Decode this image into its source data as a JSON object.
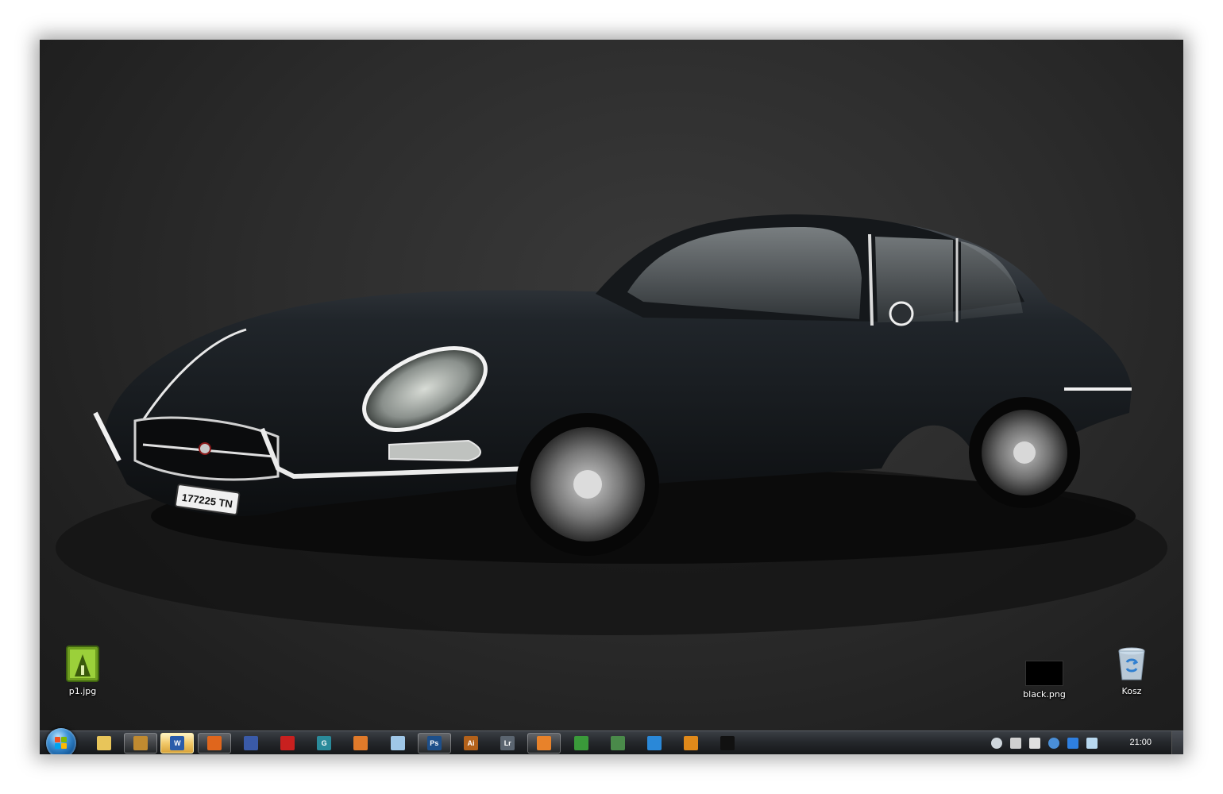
{
  "desktop_icons": [
    {
      "name": "p1-jpg",
      "label": "p1.jpg"
    },
    {
      "name": "black-png",
      "label": "black.png"
    },
    {
      "name": "recycle-bin",
      "label": "Kosz"
    }
  ],
  "car": {
    "license_plate": "177225 TN"
  },
  "taskbar": {
    "apps": [
      {
        "name": "explorer",
        "icon": "folder-icon",
        "glyph": "",
        "color": "#e8c55a",
        "state": "normal"
      },
      {
        "name": "media-app",
        "icon": "film-icon",
        "glyph": "",
        "color": "#c08a30",
        "state": "open"
      },
      {
        "name": "word",
        "icon": "word-icon",
        "glyph": "W",
        "color": "#2a5caa",
        "state": "active"
      },
      {
        "name": "firefox",
        "icon": "firefox-icon",
        "glyph": "",
        "color": "#e0661c",
        "state": "open"
      },
      {
        "name": "save-app",
        "icon": "floppy-icon",
        "glyph": "",
        "color": "#3a5aa8",
        "state": "normal"
      },
      {
        "name": "acrobat",
        "icon": "acrobat-icon",
        "glyph": "",
        "color": "#c8201f",
        "state": "normal"
      },
      {
        "name": "app-g",
        "icon": "g-icon",
        "glyph": "G",
        "color": "#2a8a9a",
        "state": "normal"
      },
      {
        "name": "app-flame",
        "icon": "flame-icon",
        "glyph": "",
        "color": "#e07a2a",
        "state": "normal"
      },
      {
        "name": "notepad",
        "icon": "notepad-icon",
        "glyph": "",
        "color": "#9fc7e8",
        "state": "normal"
      },
      {
        "name": "photoshop",
        "icon": "photoshop-icon",
        "glyph": "Ps",
        "color": "#1d4f8a",
        "state": "open"
      },
      {
        "name": "illustrator",
        "icon": "illustrator-icon",
        "glyph": "Ai",
        "color": "#b3611a",
        "state": "normal"
      },
      {
        "name": "lightroom",
        "icon": "lightroom-icon",
        "glyph": "Lr",
        "color": "#5b6570",
        "state": "normal"
      },
      {
        "name": "blender",
        "icon": "blender-icon",
        "glyph": "",
        "color": "#e8822a",
        "state": "open"
      },
      {
        "name": "utorrent",
        "icon": "utorrent-icon",
        "glyph": "",
        "color": "#3a9a3a",
        "state": "normal"
      },
      {
        "name": "image-app",
        "icon": "picture-icon",
        "glyph": "",
        "color": "#4a8a4a",
        "state": "normal"
      },
      {
        "name": "app-blue",
        "icon": "window-icon",
        "glyph": "",
        "color": "#2a88d8",
        "state": "normal"
      },
      {
        "name": "media-player",
        "icon": "play-icon",
        "glyph": "",
        "color": "#e0891a",
        "state": "normal"
      },
      {
        "name": "app-red",
        "icon": "slash-icon",
        "glyph": "",
        "color": "#111111",
        "state": "normal"
      }
    ],
    "tray_icons": [
      "globe-icon",
      "network-up-icon",
      "network-icon",
      "browser-icon",
      "dropbox-icon",
      "monitor-icon"
    ],
    "clock": "21:00"
  }
}
